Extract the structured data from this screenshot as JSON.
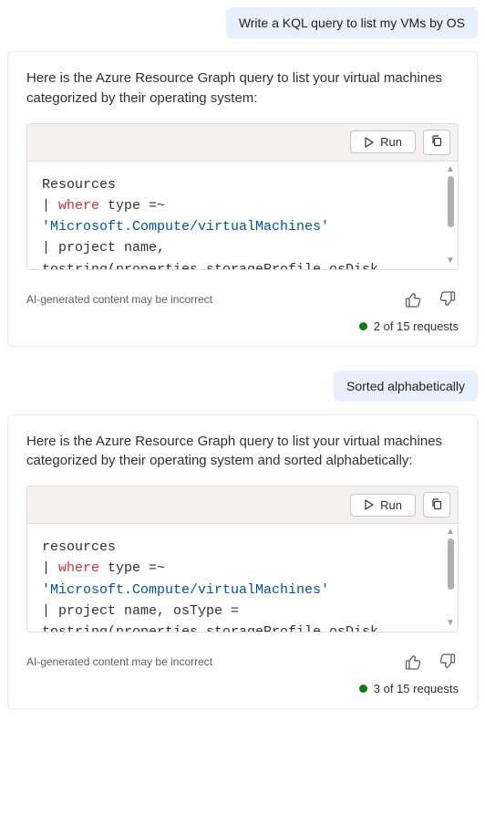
{
  "messages": [
    {
      "role": "user",
      "text": "Write a KQL query to list my VMs by OS"
    },
    {
      "role": "assistant",
      "intro": "Here is the Azure Resource Graph query to list your virtual machines categorized by their operating system:",
      "code": {
        "run_label": "Run",
        "lines": [
          {
            "plain": "Resources"
          },
          {
            "prefix": "| ",
            "kw": "where",
            "rest": " type =~"
          },
          {
            "str": "'Microsoft.Compute/virtualMachines'"
          },
          {
            "plain": "| project name,"
          },
          {
            "plain_cut": "tostring(properties.storageProfile.osDisk"
          }
        ]
      },
      "disclaimer": "AI-generated content may be incorrect",
      "requests": "2 of 15 requests"
    },
    {
      "role": "user",
      "text": "Sorted alphabetically"
    },
    {
      "role": "assistant",
      "intro": "Here is the Azure Resource Graph query to list your virtual machines categorized by their operating system and sorted alphabetically:",
      "code": {
        "run_label": "Run",
        "lines": [
          {
            "plain": "resources"
          },
          {
            "prefix": "| ",
            "kw": "where",
            "rest": " type =~"
          },
          {
            "str": "'Microsoft.Compute/virtualMachines'"
          },
          {
            "plain": "| project name, osType ="
          },
          {
            "plain_cut": "tostring(properties.storageProfile.osDisk"
          }
        ]
      },
      "disclaimer": "AI-generated content may be incorrect",
      "requests": "3 of 15 requests"
    }
  ],
  "icons": {
    "play": "play-icon",
    "copy": "copy-icon",
    "thumbs_up": "thumbs-up-icon",
    "thumbs_down": "thumbs-down-icon"
  }
}
